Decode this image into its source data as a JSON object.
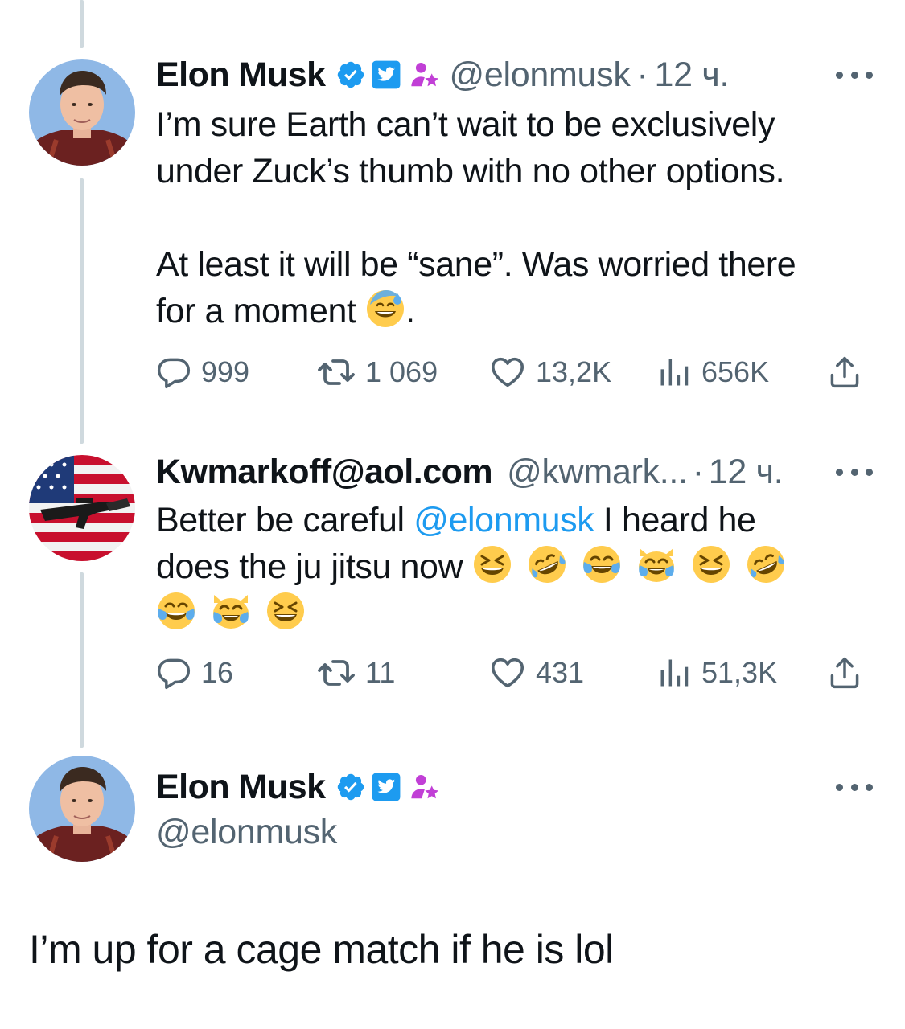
{
  "tweets": [
    {
      "name": "Elon Musk",
      "handle": "@elonmusk",
      "sep": "·",
      "time": "12 ч.",
      "text_lines": [
        "I’m sure Earth can’t wait to be exclusively",
        "under Zuck’s thumb with no other options."
      ],
      "text2_before_emoji": "At least it will be “sane”. Was worried there",
      "text2_line2": "for a moment",
      "text2_after_emoji": ".",
      "replies": "999",
      "retweets": "1 069",
      "likes": "13,2K",
      "views": "656K"
    },
    {
      "name": "Kwmarkoff@aol.com",
      "handle": "@kwmark...",
      "sep": "·",
      "time": "12 ч.",
      "text_before_mention": "Better be careful ",
      "mention": "@elonmusk",
      "text_after_mention": " I heard he",
      "text_line2": "does the ju jitsu now",
      "replies": "16",
      "retweets": "11",
      "likes": "431",
      "views": "51,3K"
    },
    {
      "name": "Elon Musk",
      "handle": "@elonmusk",
      "text": "I’m up for a cage match if he is lol"
    }
  ],
  "icons": {
    "verified": "verified-badge-icon",
    "affiliate": "twitter-affiliate-icon",
    "role": "person-star-icon",
    "reply": "reply-icon",
    "retweet": "retweet-icon",
    "like": "heart-icon",
    "views": "views-icon",
    "share": "share-icon"
  },
  "colors": {
    "accent": "#1d9bf0",
    "muted": "#536471",
    "text": "#0f1419",
    "thread_line": "#cfd9de",
    "role_purple": "#c13fd6"
  }
}
